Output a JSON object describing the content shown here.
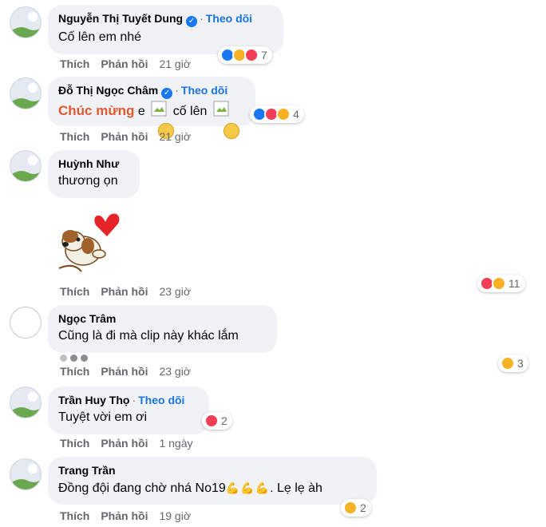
{
  "comments": [
    {
      "name": "Nguyễn Thị Tuyết Dung",
      "verified": true,
      "follow": "Theo dõi",
      "text": "Cố lên em nhé",
      "like": "Thích",
      "reply": "Phản hồi",
      "time": "21 giờ",
      "reaction_count": "7",
      "reactions": [
        "like",
        "care",
        "love"
      ]
    },
    {
      "name": "Đỗ Thị Ngọc Châm",
      "verified": true,
      "follow": "Theo dõi",
      "text_highlight": "Chúc mừng",
      "text_a": "e",
      "text_b": "cố lên",
      "like": "Thích",
      "reply": "Phản hồi",
      "time": "21 giờ",
      "reaction_count": "4",
      "reactions": [
        "like",
        "love",
        "care"
      ]
    },
    {
      "name": "Huỳnh Như",
      "text": "thương ọn",
      "like": "Thích",
      "reply": "Phản hồi",
      "time": "23 giờ",
      "reaction_count": "11",
      "reactions": [
        "love",
        "care"
      ]
    },
    {
      "name": "Ngọc Trâm",
      "text": "Cũng là đi mà clip này khác lắm",
      "like": "Thích",
      "reply": "Phản hồi",
      "time": "23 giờ",
      "reaction_count": "3",
      "reactions": [
        "haha"
      ]
    },
    {
      "name": "Trần Huy Thọ",
      "follow": "Theo dõi",
      "text": "Tuyệt vời em ơi",
      "like": "Thích",
      "reply": "Phản hồi",
      "time": "1 ngày",
      "reaction_count": "2",
      "reactions": [
        "love"
      ]
    },
    {
      "name": "Trang Trần",
      "text_a": "Đồng đội đang chờ nhá No19",
      "text_b": ". Lẹ lẹ àh",
      "like": "Thích",
      "reply": "Phản hồi",
      "time": "19 giờ",
      "reaction_count": "2",
      "reactions": [
        "care"
      ]
    }
  ],
  "colors": {
    "bubble": "#f0f2f5",
    "link": "#1b74e4",
    "meta": "#65676b",
    "like": "#1877f2",
    "love": "#f33e58",
    "care": "#f7b125"
  }
}
